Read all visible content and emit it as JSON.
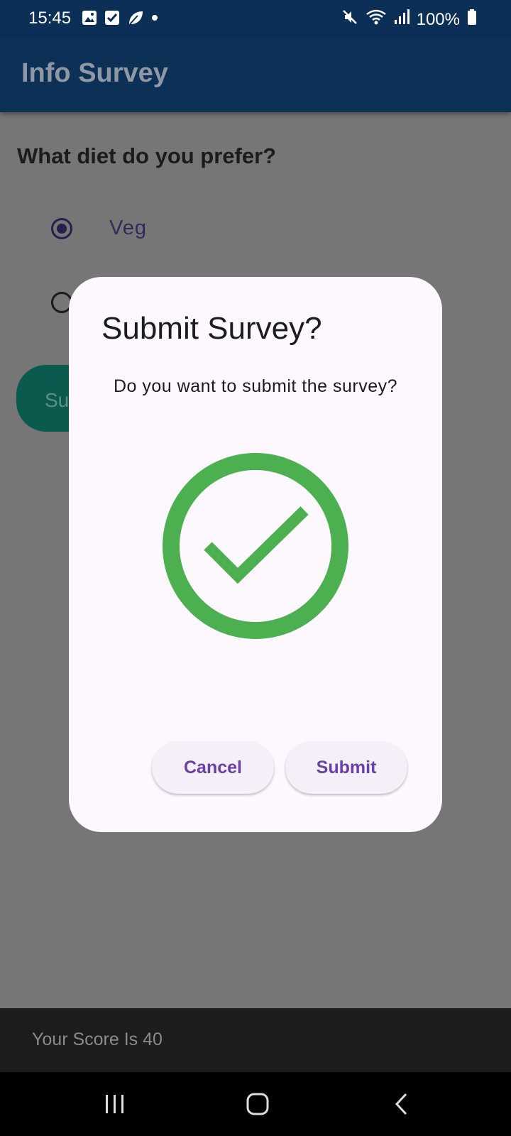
{
  "status_bar": {
    "time": "15:45",
    "battery": "100%",
    "left_icons": [
      "gallery-icon",
      "checkbox-icon",
      "leaf-icon",
      "dot-icon"
    ],
    "right_icons": [
      "mute-icon",
      "wifi-icon",
      "signal-icon",
      "battery-icon"
    ]
  },
  "app_bar": {
    "title": "Info Survey"
  },
  "survey": {
    "question": "What diet do you prefer?",
    "options": [
      {
        "label": "Veg",
        "selected": true
      },
      {
        "label": "",
        "selected": false
      }
    ],
    "submit_label_partial": "Su"
  },
  "dialog": {
    "title": "Submit Survey?",
    "message": "Do you want to submit the survey?",
    "icon": "check-circle-icon",
    "icon_color": "#4caf50",
    "cancel_label": "Cancel",
    "submit_label": "Submit"
  },
  "score": {
    "text": "Your Score Is 40"
  },
  "nav": {
    "buttons": [
      "recents-icon",
      "home-icon",
      "back-icon"
    ]
  },
  "colors": {
    "app_bar": "#0c3056",
    "accent": "#6a3fa8",
    "scrim": "#767676",
    "dialog_bg": "#fdf8fd",
    "success": "#4caf50"
  }
}
